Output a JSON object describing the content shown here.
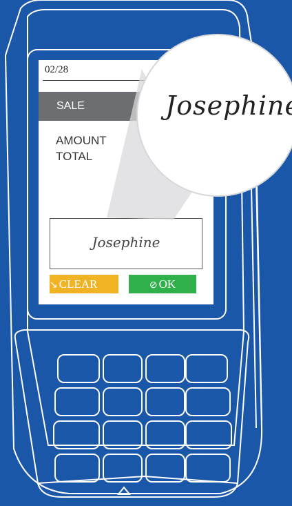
{
  "screen": {
    "date": "02/28",
    "transaction_type": "SALE",
    "amount_label": "AMOUNT",
    "total_label": "TOTAL",
    "signature": "Josephine"
  },
  "buttons": {
    "clear": {
      "label": "CLEAR",
      "icon": "eraser-icon",
      "color": "#f0b323"
    },
    "ok": {
      "label": "OK",
      "icon": "check-circle-icon",
      "color": "#2fb04b"
    }
  },
  "magnifier": {
    "signature": "Josephine"
  },
  "colors": {
    "background": "#1b57a8",
    "sale_bar": "#6d6e71"
  }
}
